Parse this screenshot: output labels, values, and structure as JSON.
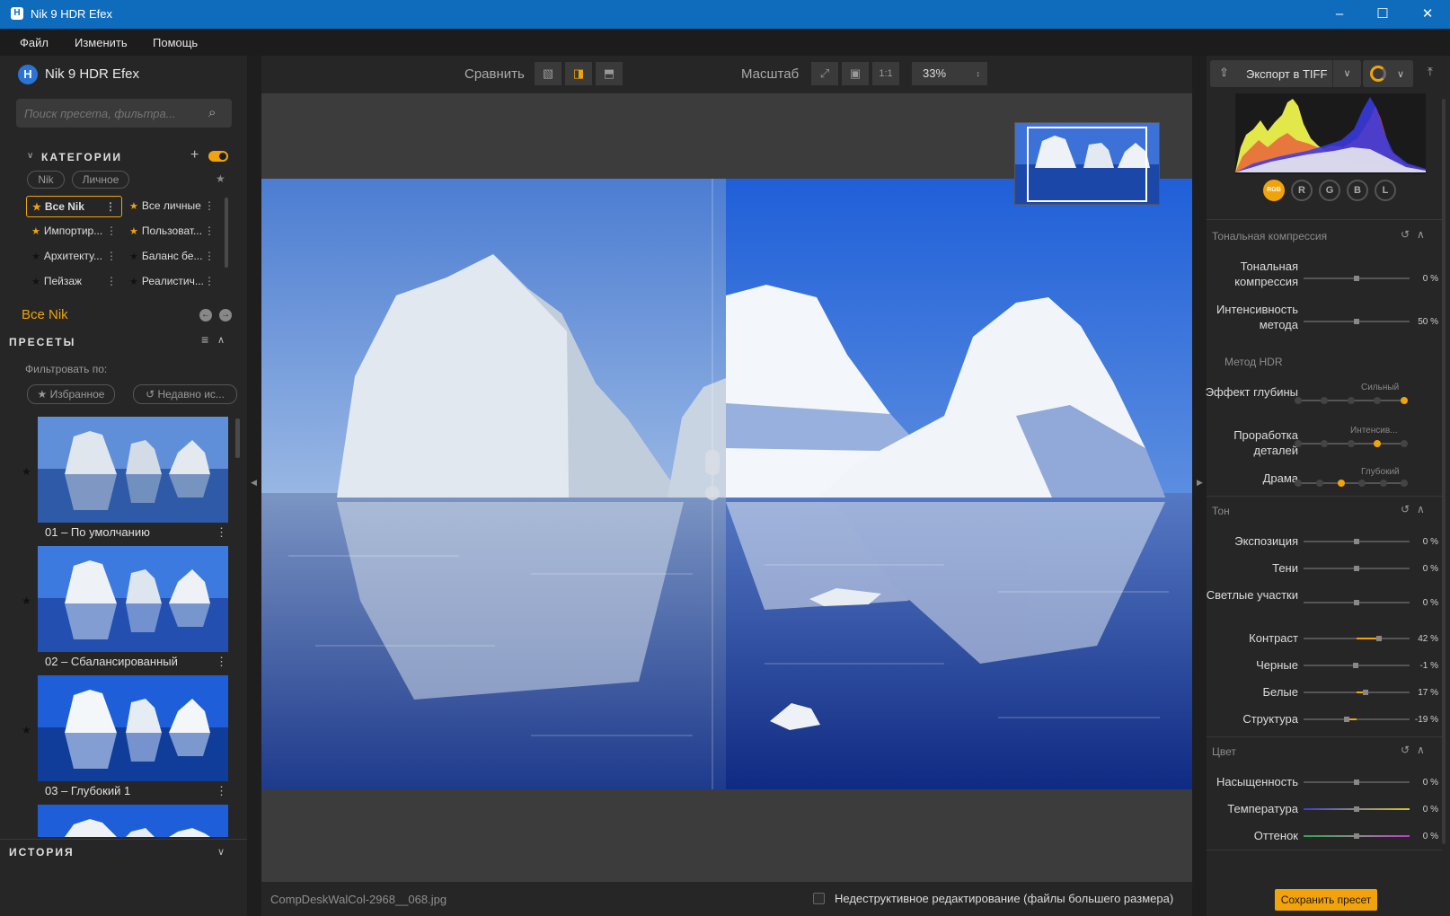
{
  "window": {
    "title": "Nik 9 HDR Efex",
    "app_icon": "H"
  },
  "menu": [
    "Файл",
    "Изменить",
    "Помощь"
  ],
  "brand": "Nik 9 HDR Efex",
  "search": {
    "placeholder": "Поиск пресета, фильтра..."
  },
  "categories": {
    "title": "КАТЕГОРИИ",
    "filters": [
      "Nik",
      "Личное"
    ],
    "items": [
      {
        "label": "Все Nik"
      },
      {
        "label": "Все личные"
      },
      {
        "label": "Импортир..."
      },
      {
        "label": "Пользоват..."
      },
      {
        "label": "Архитекту..."
      },
      {
        "label": "Баланс бе..."
      },
      {
        "label": "Пейзаж"
      },
      {
        "label": "Реалистич..."
      }
    ]
  },
  "current_category": "Все Nik",
  "presets": {
    "title": "ПРЕСЕТЫ",
    "filter_label": "Фильтровать по:",
    "filter_buttons": [
      "Избранное",
      "Недавно ис..."
    ],
    "items": [
      "01 – По умолчанию",
      "02 – Сбалансированный",
      "03 – Глубокий 1"
    ]
  },
  "history": {
    "title": "ИСТОРИЯ"
  },
  "toolbar": {
    "compare_label": "Сравнить",
    "zoom_label": "Масштаб",
    "zoom_one": "1:1",
    "zoom_value": "33%"
  },
  "status": {
    "filename": "CompDeskWalCol-2968__068.jpg",
    "nondestructive_label": "Недеструктивное редактирование (файлы большего размера)"
  },
  "export": {
    "label": "Экспорт в TIFF"
  },
  "channels": [
    "RGB",
    "R",
    "G",
    "B",
    "L"
  ],
  "sections": {
    "tonal": {
      "title": "Тональная компрессия",
      "sliders": [
        {
          "label": "Тональная компрессия",
          "value": "0 %",
          "level": 0.5
        },
        {
          "label": "Интенсивность метода",
          "value": "50 %",
          "level": 0.5
        }
      ]
    },
    "hdr": {
      "title": "Метод HDR",
      "steps": [
        {
          "label": "Эффект глубины",
          "step_label": "Сильный",
          "step": 4
        },
        {
          "label": "Проработка деталей",
          "step_label": "Интенсив...",
          "step": 3
        },
        {
          "label": "Драма",
          "step_label": "Глубокий",
          "step": 1
        }
      ]
    },
    "tone": {
      "title": "Тон",
      "sliders": [
        {
          "label": "Экспозиция",
          "value": "0 %",
          "level": 0.5
        },
        {
          "label": "Тени",
          "value": "0 %",
          "level": 0.5
        },
        {
          "label": "Светлые участки",
          "value": "0 %",
          "level": 0.5
        },
        {
          "label": "Контраст",
          "value": "42 %",
          "level": 0.71
        },
        {
          "label": "Черные",
          "value": "-1 %",
          "level": 0.495
        },
        {
          "label": "Белые",
          "value": "17 %",
          "level": 0.585
        },
        {
          "label": "Структура",
          "value": "-19 %",
          "level": 0.405
        }
      ]
    },
    "color": {
      "title": "Цвет",
      "sliders": [
        {
          "label": "Насыщенность",
          "value": "0 %",
          "level": 0.5
        },
        {
          "label": "Температура",
          "value": "0 %",
          "level": 0.5
        },
        {
          "label": "Оттенок",
          "value": "0 %",
          "level": 0.5
        }
      ]
    }
  },
  "save_preset": "Сохранить пресет",
  "colors": {
    "accent": "#f0a30a",
    "titlebar": "#0f6cbd",
    "panel": "#262626",
    "sky": "#2f6fd6",
    "water": "#1c3f95"
  }
}
